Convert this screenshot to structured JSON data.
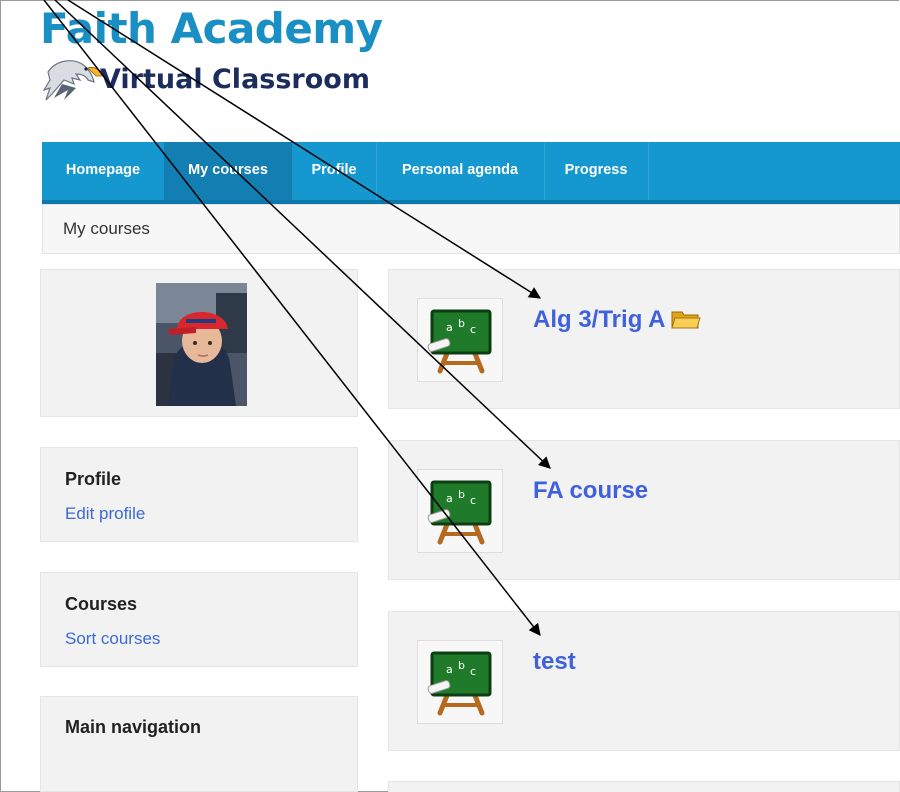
{
  "header": {
    "title": "Faith Academy",
    "subtitle": "Virtual Classroom",
    "logo_icon": "eagle-icon"
  },
  "nav": {
    "items": [
      {
        "label": "Homepage"
      },
      {
        "label": "My courses"
      },
      {
        "label": "Profile"
      },
      {
        "label": "Personal agenda"
      },
      {
        "label": "Progress"
      }
    ],
    "active": "My courses",
    "color": "#1598d0"
  },
  "breadcrumb": {
    "current": "My courses"
  },
  "sidebar": {
    "profile_block": {
      "heading": "Profile",
      "link": "Edit profile"
    },
    "courses_block": {
      "heading": "Courses",
      "link": "Sort courses"
    },
    "navigation_block": {
      "heading": "Main navigation"
    }
  },
  "courses": [
    {
      "name": "Alg 3/Trig A",
      "icon": "chalkboard-icon",
      "badge_icon": "folder-icon"
    },
    {
      "name": "FA course",
      "icon": "chalkboard-icon"
    },
    {
      "name": "test",
      "icon": "chalkboard-icon"
    }
  ],
  "colors": {
    "link": "#3f62dc",
    "brand": "#1a8fc4"
  }
}
